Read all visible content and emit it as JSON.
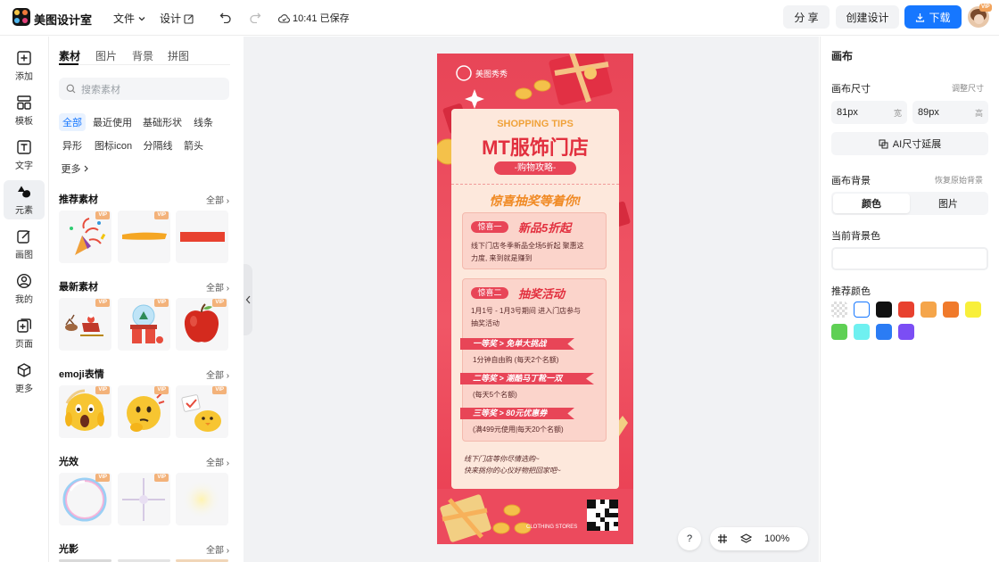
{
  "topbar": {
    "app_title": "美图设计室",
    "file_menu": "文件",
    "design_menu": "设计",
    "save_status": "10:41 已保存",
    "share_label": "分 享",
    "create_label": "创建设计",
    "download_label": "下载",
    "avatar_badge": "VIP"
  },
  "rail": {
    "items": [
      {
        "label": "添加",
        "icon": "plus-square-icon"
      },
      {
        "label": "模板",
        "icon": "layout-icon"
      },
      {
        "label": "文字",
        "icon": "text-icon"
      },
      {
        "label": "元素",
        "icon": "shapes-icon"
      },
      {
        "label": "画图",
        "icon": "edit-icon"
      },
      {
        "label": "我的",
        "icon": "user-icon"
      },
      {
        "label": "页面",
        "icon": "add-page-icon"
      },
      {
        "label": "更多",
        "icon": "cube-icon"
      }
    ]
  },
  "panel": {
    "tabs": [
      "素材",
      "图片",
      "背景",
      "拼图"
    ],
    "search_placeholder": "搜索素材",
    "chips": [
      "全部",
      "最近使用",
      "基础形状",
      "线条",
      "异形",
      "图标icon",
      "分隔线",
      "箭头",
      "更多"
    ],
    "all_label": "全部",
    "vip_label": "VIP",
    "sections": [
      {
        "title": "推荐素材"
      },
      {
        "title": "最新素材"
      },
      {
        "title": "emoji表情"
      },
      {
        "title": "光效"
      },
      {
        "title": "光影"
      }
    ]
  },
  "poster": {
    "brand": "美图秀秀",
    "shopping_tips": "SHOPPING TIPS",
    "headline": "MT服饰门店",
    "subhead": "-购物攻略-",
    "lottery_title": "惊喜抽奖等着你!",
    "surprise1_tag": "惊喜一",
    "surprise1_title": "新品5折起",
    "surprise1_line1": "线下门店冬季新品全场5折起 聚惠这",
    "surprise1_line2": "力度, 来到就是赚到",
    "surprise2_tag": "惊喜二",
    "surprise2_title": "抽奖活动",
    "surprise2_line1": "1月1号 - 1月3号期间 进入门店参与",
    "surprise2_line2": "抽奖活动",
    "prize1": "一等奖 > 免单大挑战",
    "prize1_desc": "1分钟自由购 (每天2个名额)",
    "prize2": "二等奖 > 潮酷马丁靴一双",
    "prize2_desc": "(每天5个名额)",
    "prize3": "三等奖 > 80元优惠券",
    "prize3_desc": "(满499元使用|每天20个名额)",
    "footer_line1": "线下门店等你尽情选购~",
    "footer_line2": "快来挑你的心仪好物把回家吧~",
    "clothing_label": "CLOTHING STORES"
  },
  "canvas_controls": {
    "help": "?",
    "zoom": "100%"
  },
  "props": {
    "title": "画布",
    "size_label": "画布尺寸",
    "adjust_size": "调整尺寸",
    "width_value": "81px",
    "width_unit": "宽",
    "height_value": "89px",
    "height_unit": "高",
    "ai_extend": "AI尺寸延展",
    "bg_label": "画布背景",
    "restore_bg": "恢复原始背景",
    "seg_color": "颜色",
    "seg_image": "图片",
    "current_bg": "当前背景色",
    "recommended": "推荐颜色",
    "swatches": [
      "transparent",
      "#ffffff",
      "#111111",
      "#e8412f",
      "#f5a54a",
      "#f07a2b",
      "#f8ef3a",
      "#5fd054",
      "#6ff0f0",
      "#2b7cf4",
      "#7b4ef4"
    ],
    "accent": "#1677ff"
  }
}
